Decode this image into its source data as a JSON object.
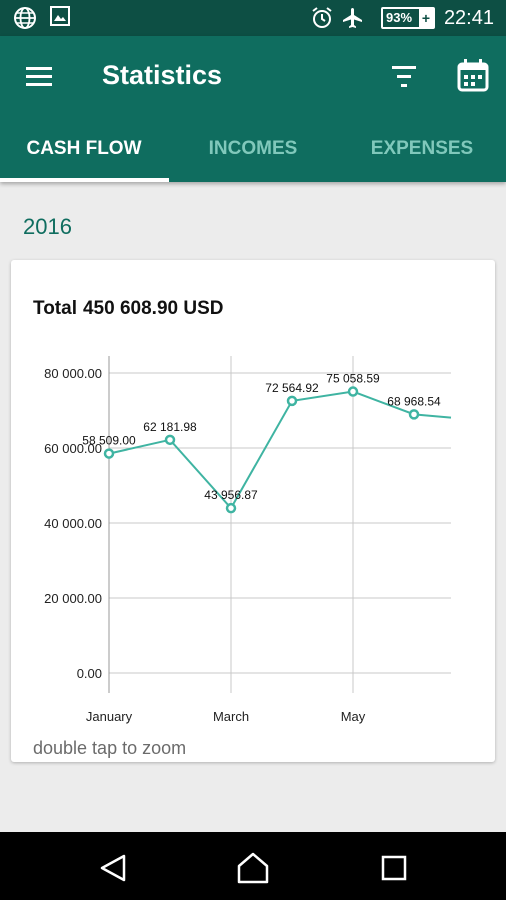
{
  "status_bar": {
    "time": "22:41",
    "battery": "93%",
    "battery_charging_symbol": "+",
    "icons": [
      "globe-icon",
      "image-icon",
      "alarm-icon",
      "airplane-mode-icon",
      "battery-icon"
    ]
  },
  "app_bar": {
    "title": "Statistics",
    "icons": [
      "menu-icon",
      "filter-icon",
      "calendar-icon"
    ],
    "tabs": [
      {
        "label": "CASH FLOW",
        "active": true
      },
      {
        "label": "INCOMES",
        "active": false
      },
      {
        "label": "EXPENSES",
        "active": false
      }
    ]
  },
  "colors": {
    "primary": "#0f6d5f",
    "primary_dark": "#0d4f44",
    "tab_inactive": "#80c8bb",
    "line": "#3fb4a2",
    "background": "#ececec"
  },
  "section": {
    "year": "2016"
  },
  "summary": {
    "total_label": "Total",
    "total_value": "450 608.90 USD"
  },
  "chart_data": {
    "type": "line",
    "x_tick_labels": [
      "January",
      "March",
      "May"
    ],
    "y_tick_labels": [
      "0.00",
      "20 000.00",
      "40 000.00",
      "60 000.00",
      "80 000.00"
    ],
    "ylim": [
      0,
      80000
    ],
    "series": [
      {
        "points": [
          {
            "month": 1,
            "value": 58509.0,
            "label": "58 509.00"
          },
          {
            "month": 2,
            "value": 62181.98,
            "label": "62 181.98"
          },
          {
            "month": 3,
            "value": 43956.87,
            "label": "43 956.87"
          },
          {
            "month": 4,
            "value": 72564.92,
            "label": "72 564.92"
          },
          {
            "month": 5,
            "value": 75058.59,
            "label": "75 058.59"
          },
          {
            "month": 6,
            "value": 68968.54,
            "label": "68 968.54"
          }
        ],
        "continues_right_value": 68100
      }
    ],
    "grid": true
  },
  "hint": "double tap to zoom",
  "nav_bar": {
    "buttons": [
      "back-icon",
      "home-icon",
      "recents-icon"
    ]
  }
}
